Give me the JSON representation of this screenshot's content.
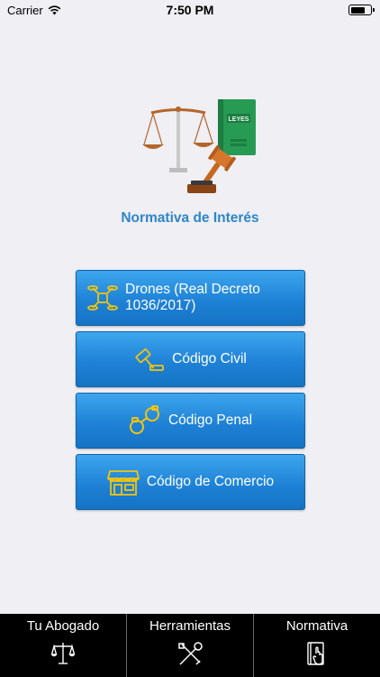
{
  "status_bar": {
    "carrier": "Carrier",
    "time": "7:50 PM"
  },
  "header": {
    "logo_book_label": "LEYES",
    "title": "Normativa de Interés"
  },
  "menu": [
    {
      "label_line1": "Drones (Real Decreto",
      "label_line2": "1036/2017)",
      "icon": "drone-icon"
    },
    {
      "label": "Código Civil",
      "icon": "gavel-icon"
    },
    {
      "label": "Código Penal",
      "icon": "handcuffs-icon"
    },
    {
      "label": "Código de Comercio",
      "icon": "store-icon"
    }
  ],
  "tabbar": [
    {
      "label": "Tu Abogado",
      "icon": "scales-icon"
    },
    {
      "label": "Herramientas",
      "icon": "tools-icon"
    },
    {
      "label": "Normativa",
      "icon": "law-book-icon"
    }
  ],
  "colors": {
    "accent": "#2e86c9",
    "button": "#1f82d6",
    "icon_yellow": "#f1c40f",
    "tabbar": "#000000"
  }
}
